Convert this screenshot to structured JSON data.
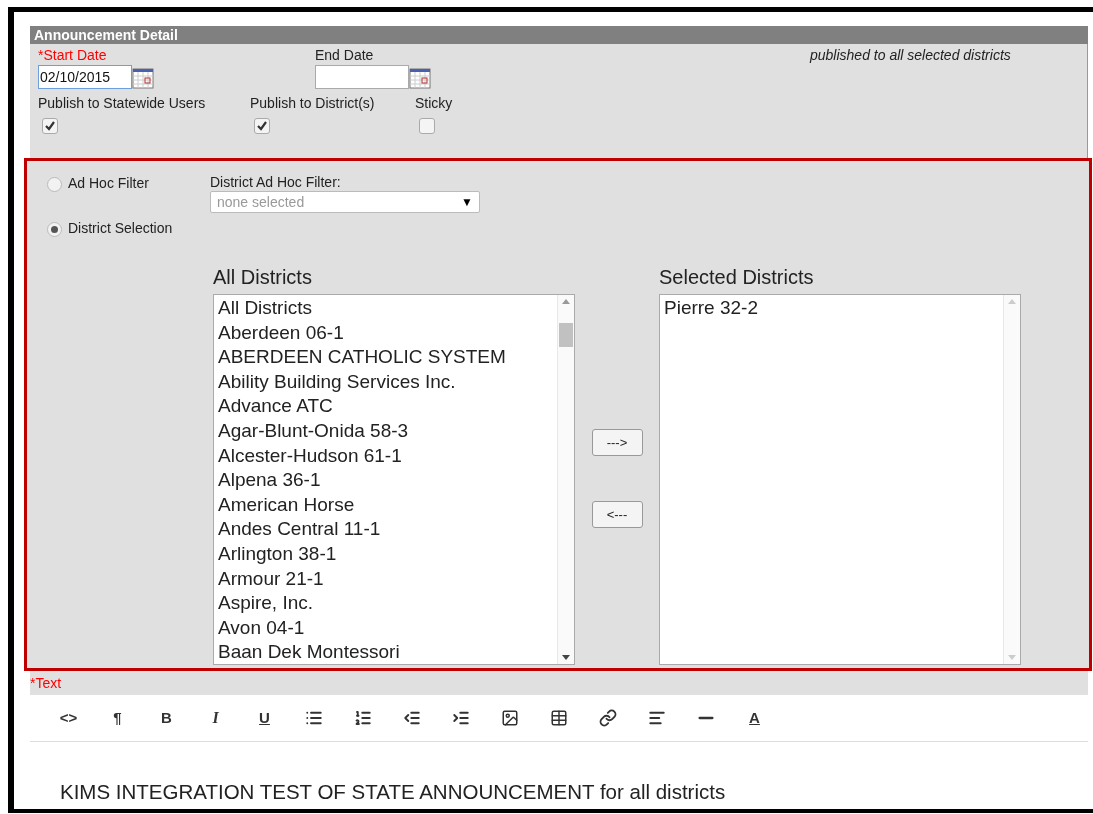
{
  "panel": {
    "title": "Announcement Detail"
  },
  "start_date": {
    "label": "*Start Date",
    "value": "02/10/2015",
    "required": true
  },
  "end_date": {
    "label": "End Date",
    "required": false
  },
  "note": "published to all selected districts",
  "checkboxes": [
    {
      "label": "Publish to Statewide Users",
      "checked": true
    },
    {
      "label": "Publish to District(s)",
      "checked": true
    },
    {
      "label": "Sticky",
      "checked": false
    }
  ],
  "radios": [
    {
      "label": "Ad Hoc Filter",
      "selected": false
    },
    {
      "label": "District Selection",
      "selected": true
    }
  ],
  "adhoc_filter": {
    "label": "District Ad Hoc Filter:",
    "placeholder": "none selected",
    "arrow": "▼"
  },
  "all_districts": {
    "heading": "All Districts",
    "items": [
      "All Districts",
      "Aberdeen 06-1",
      "ABERDEEN CATHOLIC SYSTEM",
      "Ability Building Services Inc.",
      "Advance ATC",
      "Agar-Blunt-Onida 58-3",
      "Alcester-Hudson 61-1",
      "Alpena 36-1",
      "American Horse",
      "Andes Central 11-1",
      "Arlington 38-1",
      "Armour 21-1",
      "Aspire, Inc.",
      "Avon 04-1",
      "Baan Dek Montessori"
    ]
  },
  "move_buttons": [
    "--->",
    "<---"
  ],
  "selected_districts": {
    "heading": "Selected Districts",
    "items": [
      "Pierre 32-2"
    ]
  },
  "text_label": "*Text",
  "toolbar": [
    {
      "kind": "glyph",
      "label": "<>"
    },
    {
      "kind": "glyph",
      "label": "¶"
    },
    {
      "kind": "bold",
      "label": "B"
    },
    {
      "kind": "italic",
      "label": "I"
    },
    {
      "kind": "underline",
      "label": "U"
    },
    {
      "kind": "bullets"
    },
    {
      "kind": "numbers"
    },
    {
      "kind": "outdent"
    },
    {
      "kind": "indent"
    },
    {
      "kind": "image"
    },
    {
      "kind": "table"
    },
    {
      "kind": "link"
    },
    {
      "kind": "align"
    },
    {
      "kind": "rule"
    },
    {
      "kind": "underline",
      "label": "A"
    }
  ],
  "editor_text": "KIMS INTEGRATION TEST OF STATE ANNOUNCEMENT for all districts"
}
